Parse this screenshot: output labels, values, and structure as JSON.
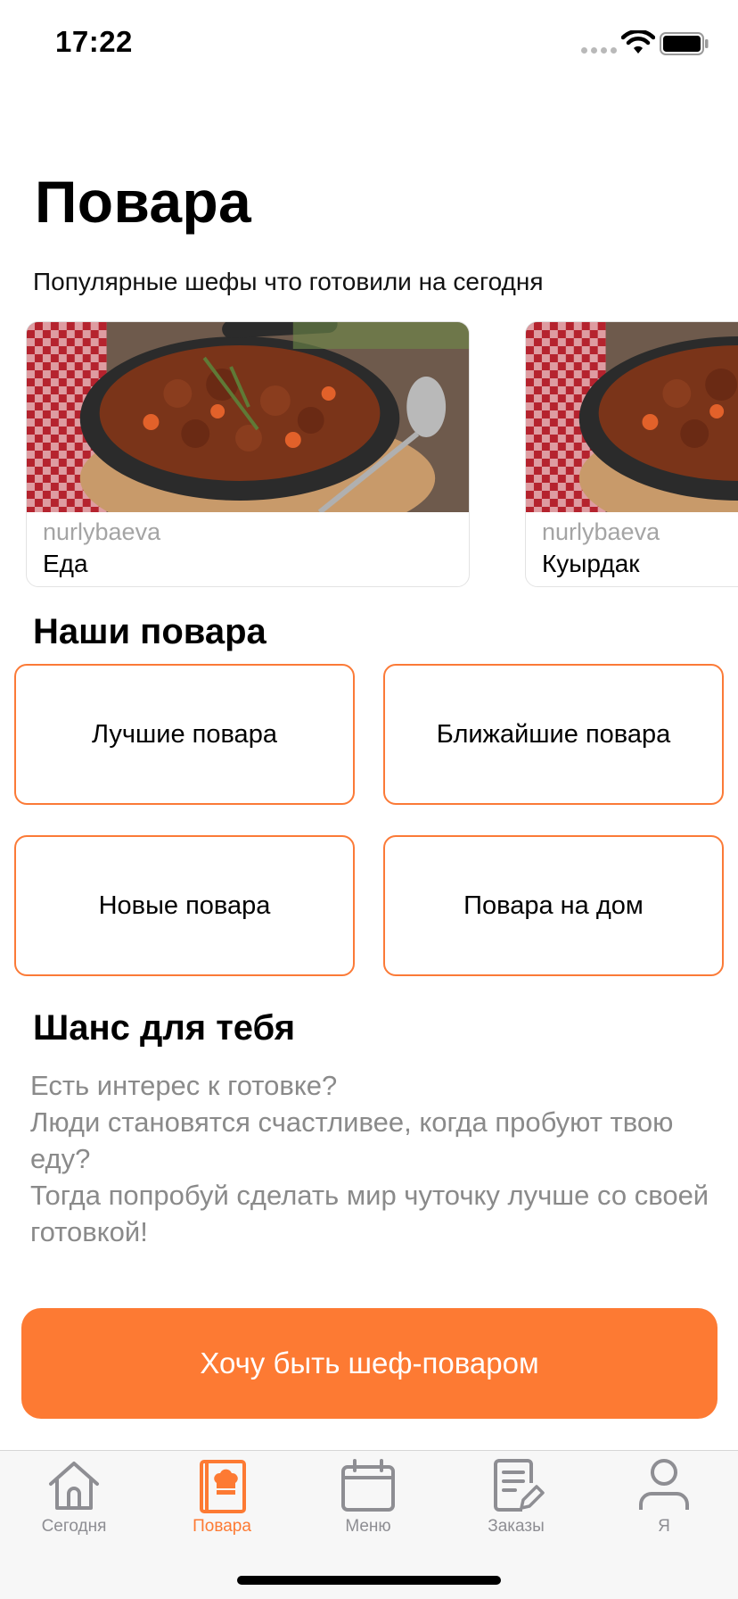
{
  "status_bar": {
    "time": "17:22"
  },
  "page": {
    "title": "Повара",
    "subtitle": "Популярные шефы что готовили на сегодня"
  },
  "dishes": [
    {
      "author": "nurlybaeva",
      "name": "Еда"
    },
    {
      "author": "nurlybaeva",
      "name": "Куырдак"
    }
  ],
  "our_chefs": {
    "title": "Наши повара",
    "buttons": [
      "Лучшие повара",
      "Ближайшие повара",
      "Новые повара",
      "Повара на дом"
    ]
  },
  "chance": {
    "title": "Шанс для тебя",
    "text": "Есть интерес к готовке?\nЛюди становятся счастливее, когда пробуют твою еду?\nТогда попробуй сделать мир чуточку лучше со своей готовкой!",
    "cta": "Хочу быть шеф-поваром"
  },
  "tab_bar": {
    "active_index": 1,
    "active_color": "#fd7a33",
    "tabs": [
      {
        "label": "Сегодня",
        "icon": "home-icon"
      },
      {
        "label": "Повара",
        "icon": "chef-book-icon"
      },
      {
        "label": "Меню",
        "icon": "calendar-icon"
      },
      {
        "label": "Заказы",
        "icon": "order-edit-icon"
      },
      {
        "label": "Я",
        "icon": "person-icon"
      }
    ]
  },
  "colors": {
    "accent": "#fd7a33",
    "muted_text": "#8a8a8a"
  }
}
